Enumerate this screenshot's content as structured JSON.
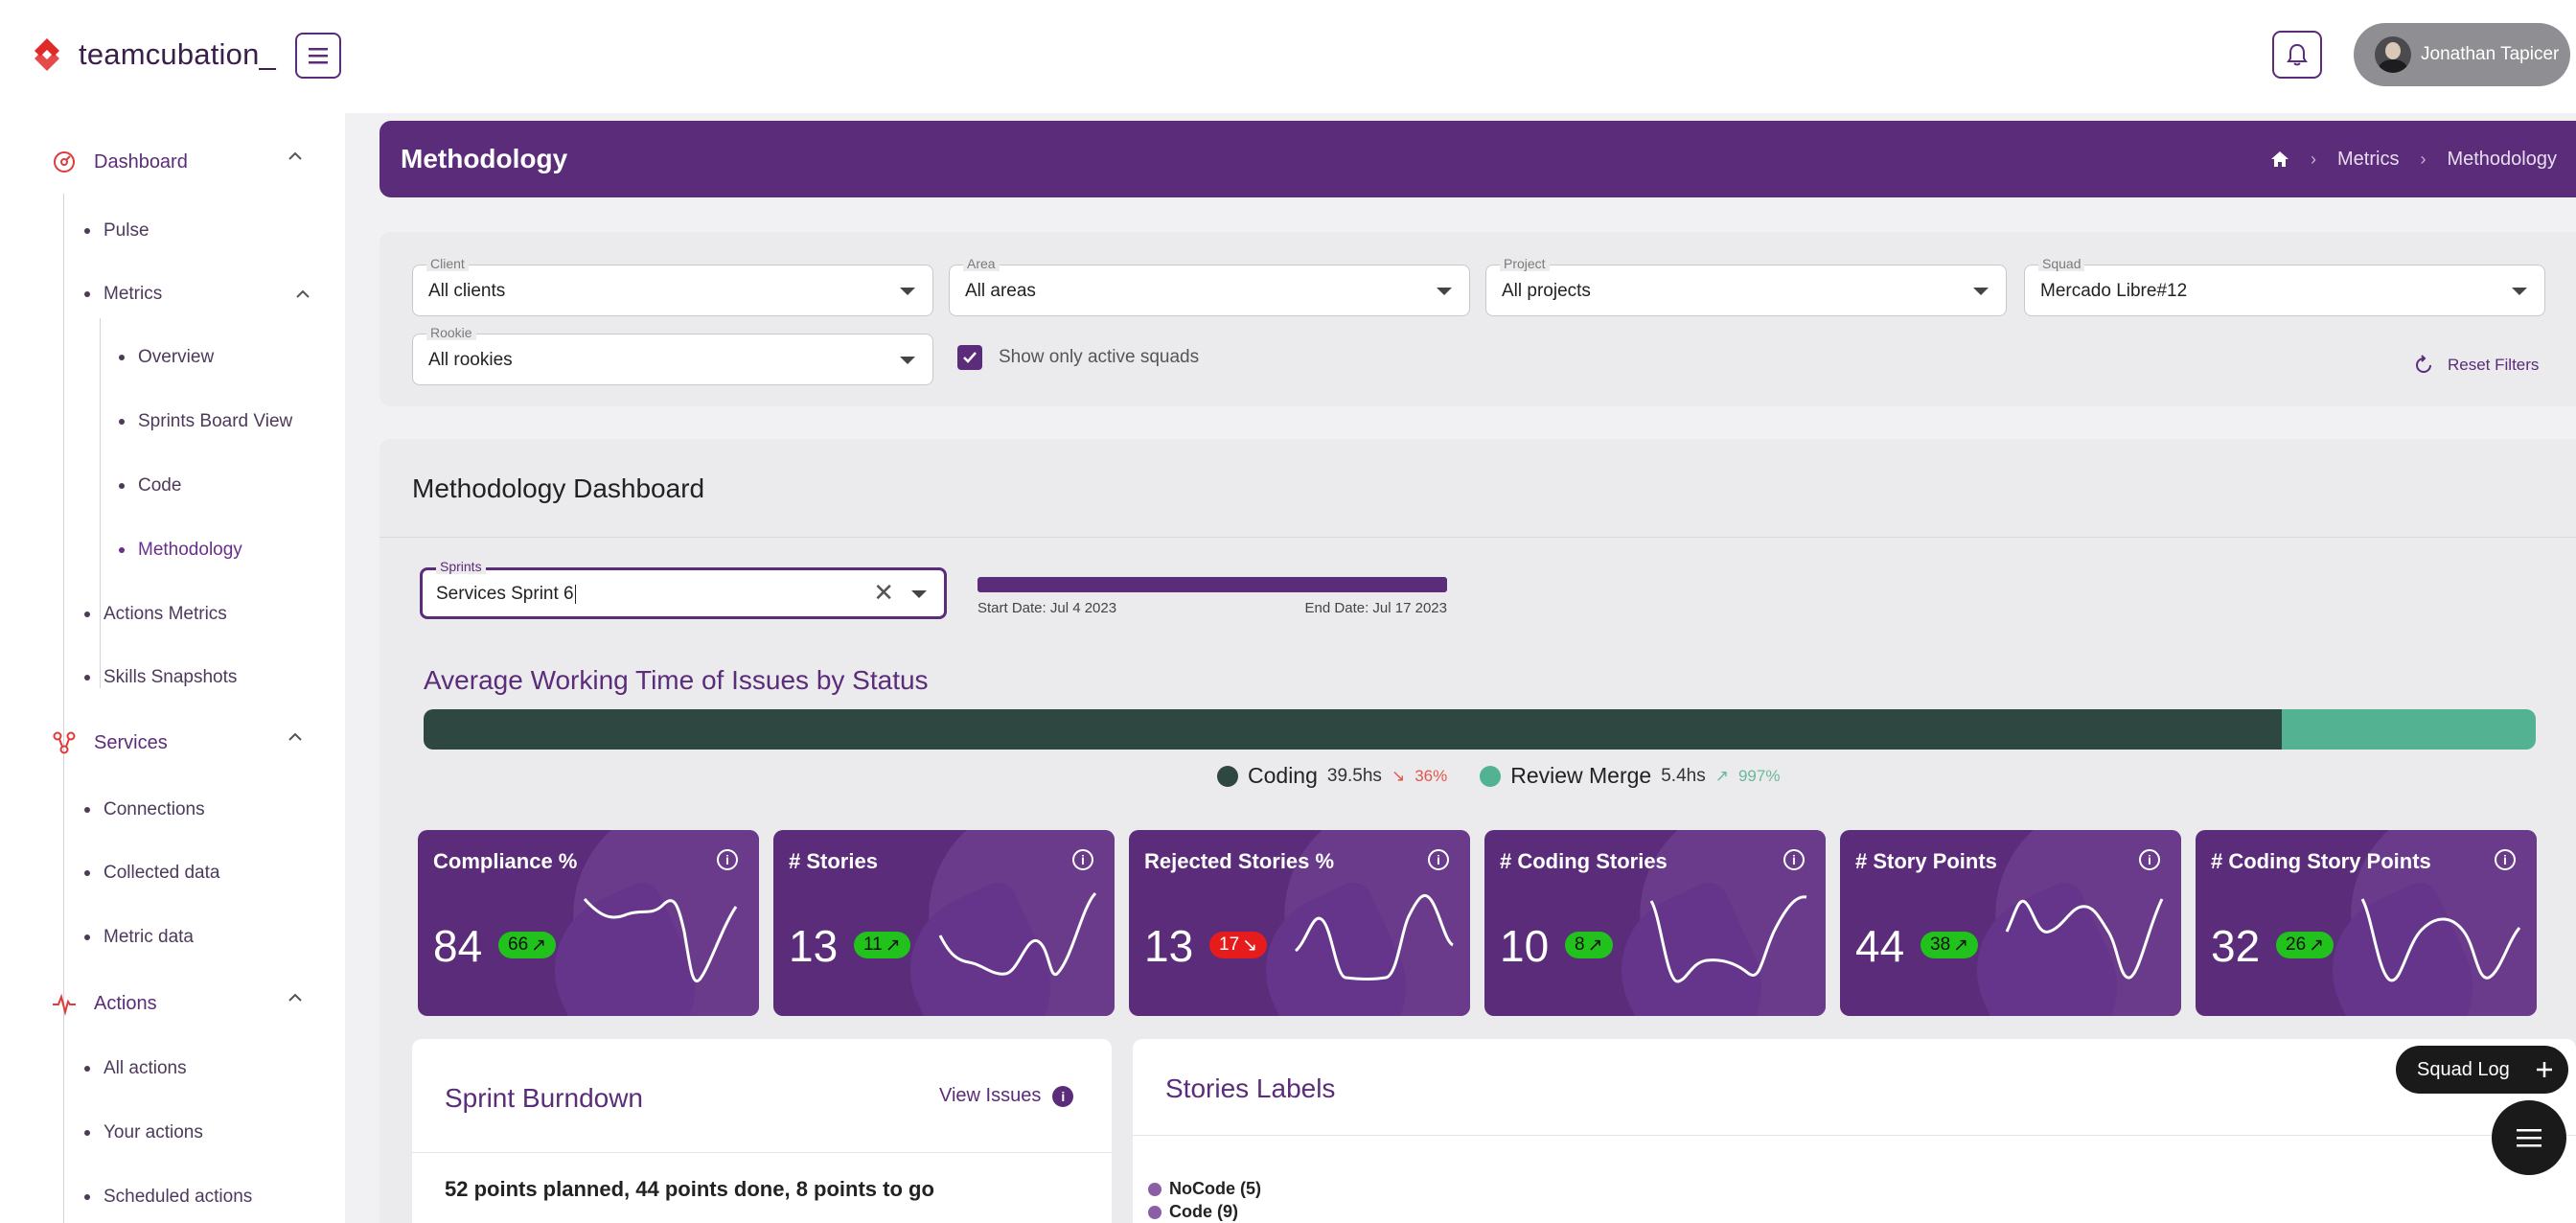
{
  "app": {
    "logo_text": "teamcubation_",
    "user_name": "Jonathan Tapicer"
  },
  "sidebar": {
    "groups": [
      {
        "label": "Dashboard",
        "icon": "dashboard-gauge-icon"
      },
      {
        "label": "Services",
        "icon": "services-nodes-icon"
      },
      {
        "label": "Actions",
        "icon": "actions-pulse-icon"
      }
    ],
    "dashboard_items": [
      "Pulse",
      "Metrics",
      "Actions Metrics",
      "Skills Snapshots"
    ],
    "metrics_items": [
      "Overview",
      "Sprints Board View",
      "Code",
      "Methodology"
    ],
    "services_items": [
      "Connections",
      "Collected data",
      "Metric data"
    ],
    "actions_items": [
      "All actions",
      "Your actions",
      "Scheduled actions"
    ],
    "active_item": "Methodology"
  },
  "header": {
    "title": "Methodology",
    "breadcrumb": [
      "Metrics",
      "Methodology"
    ]
  },
  "filters": {
    "client": {
      "label": "Client",
      "value": "All clients"
    },
    "area": {
      "label": "Area",
      "value": "All areas"
    },
    "project": {
      "label": "Project",
      "value": "All projects"
    },
    "squad": {
      "label": "Squad",
      "value": "Mercado Libre#12"
    },
    "rookie": {
      "label": "Rookie",
      "value": "All rookies"
    },
    "active_squads": {
      "label": "Show only active squads",
      "checked": true
    },
    "reset_label": "Reset Filters"
  },
  "dashboard": {
    "title": "Methodology Dashboard",
    "sprints": {
      "label": "Sprints",
      "value": "Services Sprint 6"
    },
    "start_date": "Start Date: Jul 4 2023",
    "end_date": "End Date: Jul 17 2023",
    "awt": {
      "title": "Average Working Time of Issues by Status",
      "segments": [
        {
          "name": "Coding",
          "value": "39.5hs",
          "change": "36%",
          "direction": "down",
          "color": "#2f4741",
          "hours": 39.5
        },
        {
          "name": "Review Merge",
          "value": "5.4hs",
          "change": "997%",
          "direction": "up",
          "color": "#52b292",
          "hours": 5.4
        }
      ]
    }
  },
  "kpis": [
    {
      "title": "Compliance %",
      "value": "84",
      "badge": "66",
      "direction": "up"
    },
    {
      "title": "# Stories",
      "value": "13",
      "badge": "11",
      "direction": "up"
    },
    {
      "title": "Rejected Stories %",
      "value": "13",
      "badge": "17",
      "direction": "down"
    },
    {
      "title": "# Coding Stories",
      "value": "10",
      "badge": "8",
      "direction": "up"
    },
    {
      "title": "# Story Points",
      "value": "44",
      "badge": "38",
      "direction": "up"
    },
    {
      "title": "# Coding Story Points",
      "value": "32",
      "badge": "26",
      "direction": "up"
    }
  ],
  "burndown": {
    "title": "Sprint Burndown",
    "view_issues": "View Issues",
    "summary": "52 points planned, 44 points done, 8 points to go"
  },
  "stories_labels": {
    "title": "Stories Labels",
    "items": [
      "NoCode (5)",
      "Code (9)"
    ]
  },
  "squad_log": "Squad Log"
}
